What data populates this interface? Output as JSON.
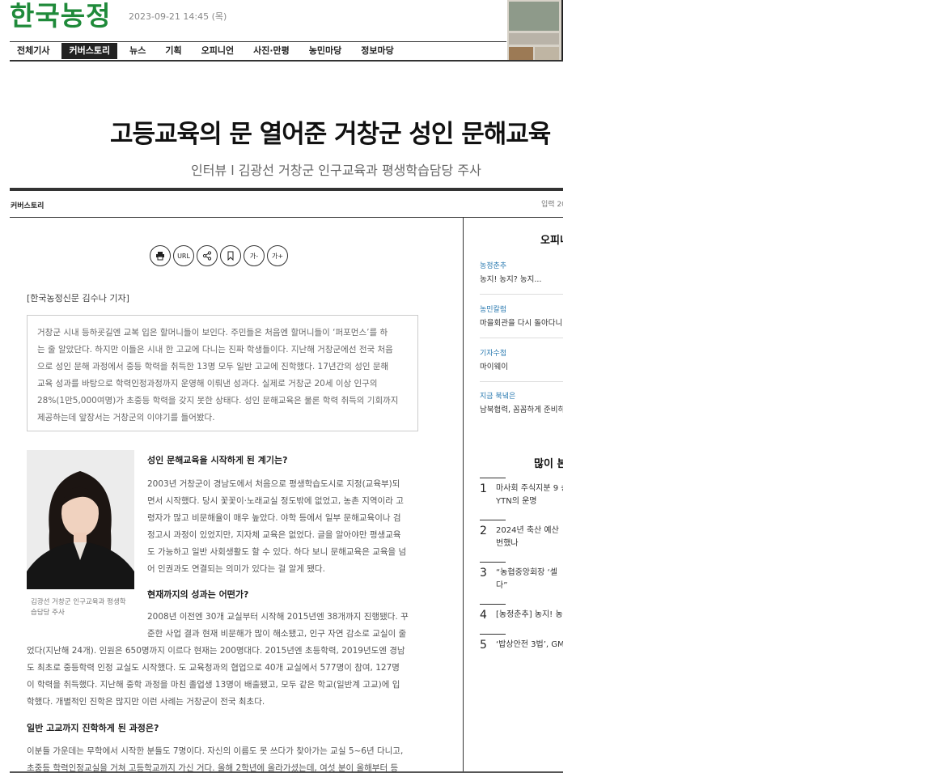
{
  "header": {
    "logo": "한국농정",
    "datetime": "2023-09-21 14:45 (목)",
    "nav": [
      "전체기사",
      "커버스토리",
      "뉴스",
      "기획",
      "오피니언",
      "사진·만평",
      "농민마당",
      "정보마당"
    ],
    "nav_active_index": 1
  },
  "article": {
    "headline": "고등교육의 문 열어준 거창군 성인 문해교육",
    "subhead": "인터뷰 l 김광선 거창군 인구교육과 평생학습담당 주사",
    "section": "커버스토리",
    "input_date": "입력 20",
    "tools": [
      "print-icon",
      "URL",
      "share-icon",
      "bookmark-icon",
      "가-",
      "가+"
    ],
    "reporter": "[한국농정신문 김수나 기자]",
    "lead_lines": [
      "거창군 시내 등하굣길엔 교복 입은 할머니들이 보인다. 주민들은 처음엔 할머니들이 ‘퍼포먼스’를 하",
      "는 줄 알았단다. 하지만 이들은 시내 한 고교에 다니는 진짜 학생들이다. 지난해 거창군에선 전국 처음",
      "으로 성인 문해 과정에서 중등 학력을 취득한 13명 모두 일반 고교에 진학했다. 17년간의 성인 문해",
      "교육 성과를 바탕으로 학력인정과정까지 운영해 이뤄낸 성과다. 실제로 거창군 20세 이상 인구의",
      "28%(1만5,000여명)가 초중등 학력을 갖지 못한 상태다. 성인 문해교육은 물론 학력 취득의 기회까지",
      "제공하는데 앞장서는 거창군의 이야기를 들어봤다."
    ],
    "caption": "김광선 거창군 인구교육과 평생학습담당 주사",
    "q1": "성인 문해교육을 시작하게 된 계기는?",
    "a1_lines": [
      "2003년 거창군이 경남도에서 처음으로 평생학습도시로 지정(교육부)되",
      "면서 시작했다. 당시 꽃꽃이·노래교실 정도밖에 없었고, 농촌 지역이라 고",
      "령자가 많고 비문해율이 매우 높았다. 야학 등에서 일부 문해교육이나 검",
      "정고시 과정이 있었지만, 지자체 교육은 없었다. 글을 알아야만 평생교육",
      "도 가능하고 일반 사회생활도 할 수 있다. 하다 보니 문해교육은 교육을 넘",
      "어 인권과도 연결되는 의미가 있다는 걸 알게 됐다."
    ],
    "q2": "현재까지의 성과는 어떤가?",
    "a2_first_lines": [
      "2008년 이전엔 30개 교실부터 시작해 2015년엔 38개까지 진행됐다. 꾸",
      "준한 사업 결과 현재 비문해가 많이 해소됐고, 인구 자연 감소로 교실이 줄"
    ],
    "a2_rest_lines": [
      "었다(지난해 24개). 인원은 650명까지 이르다 현재는 200명대다. 2015년엔 초등학력, 2019년도엔 경남",
      "도 최초로 중등학력 인정 교실도 시작했다. 도 교육청과의 협업으로 40개 교실에서 577명이 참여, 127명",
      "이 학력을 취득했다. 지난해 중학 과정을 마친 졸업생 13명이 배출됐고, 모두 같은 학교(일반계 고교)에 입",
      "학했다. 개별적인 진학은 많지만 이런 사례는 거창군이 전국 최초다."
    ],
    "q3": "일반 고교까지 진학하게 된 과정은?",
    "a3_lines": [
      "이분들 가운데는 무학에서 시작한 분들도 7명이다. 자신의 이름도 못 쓰다가 찾아가는 교실 5~6년 다니고,",
      "초중등 학력인정교실을 거쳐 고등학교까지 가신 거다. 올해 2학년에 올라가셨는데, 여섯 분이 올해부터 등"
    ]
  },
  "sidebar": {
    "opinion_title": "오피니",
    "opinion_items": [
      {
        "category": "농정춘추",
        "title": "농지! 농지? 농지..."
      },
      {
        "category": "농민칼럼",
        "title": "마을회관을 다시 돌아다니"
      },
      {
        "category": "기자수첩",
        "title": "마이웨이"
      },
      {
        "category": "지금 북녘은",
        "title": "남북협력, 꼼꼼하게 준비하"
      }
    ],
    "popular_title": "많이 본",
    "popular_items": [
      {
        "num": "1",
        "text": "마사회 주식지분 9 송 YTN의 운명"
      },
      {
        "num": "2",
        "text": "2024년 축산 예산 번했나"
      },
      {
        "num": "3",
        "text": "“농협중앙회장 ‘셀 다”"
      },
      {
        "num": "4",
        "text": "[농정춘추] 농지! 농"
      },
      {
        "num": "5",
        "text": "‘밥상안전 3법’, GM"
      }
    ]
  }
}
